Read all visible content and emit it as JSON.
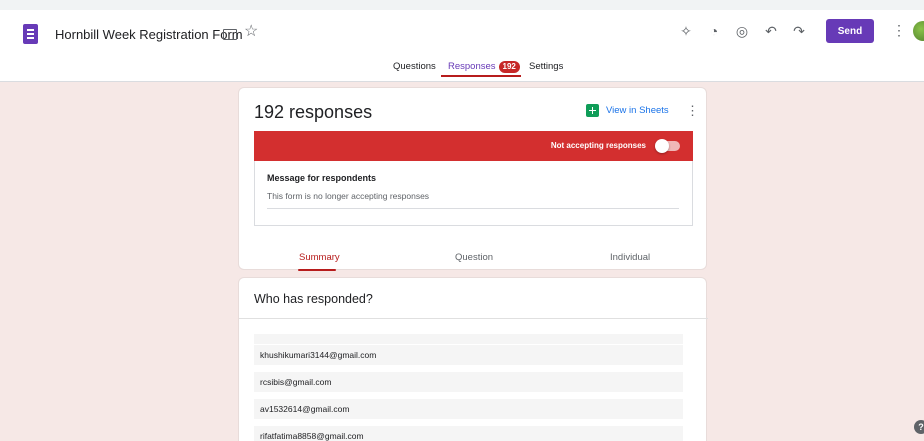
{
  "header": {
    "title": "Hornbill Week Registration Form",
    "send_label": "Send"
  },
  "tabs": [
    {
      "label": "Questions",
      "active": false
    },
    {
      "label": "Responses",
      "active": true,
      "badge": "192"
    },
    {
      "label": "Settings",
      "active": false
    }
  ],
  "responses": {
    "count_text": "192 responses",
    "sheets_label": "View in Sheets",
    "accepting_label": "Not accepting responses",
    "accepting": false,
    "message_label": "Message for respondents",
    "message_text": "This form is no longer accepting responses"
  },
  "subtabs": [
    {
      "label": "Summary",
      "active": true
    },
    {
      "label": "Question",
      "active": false
    },
    {
      "label": "Individual",
      "active": false
    }
  ],
  "who": {
    "title": "Who has responded?",
    "emails": [
      "",
      "khushikumari3144@gmail.com",
      "rcsibis@gmail.com",
      "av1532614@gmail.com",
      "rifatfatima8858@gmail.com"
    ]
  },
  "colors": {
    "brand": "#673ab7",
    "red_bar": "#d32f2f",
    "accent": "#b71c1c",
    "sheets": "#0f9d58",
    "background": "#f6e8e6"
  },
  "icons": [
    "forms-icon",
    "folder-icon",
    "star-icon",
    "customize-icon",
    "palette-icon",
    "preview-icon",
    "undo-icon",
    "redo-icon",
    "more-vert-icon",
    "sheets-icon",
    "help-icon"
  ]
}
